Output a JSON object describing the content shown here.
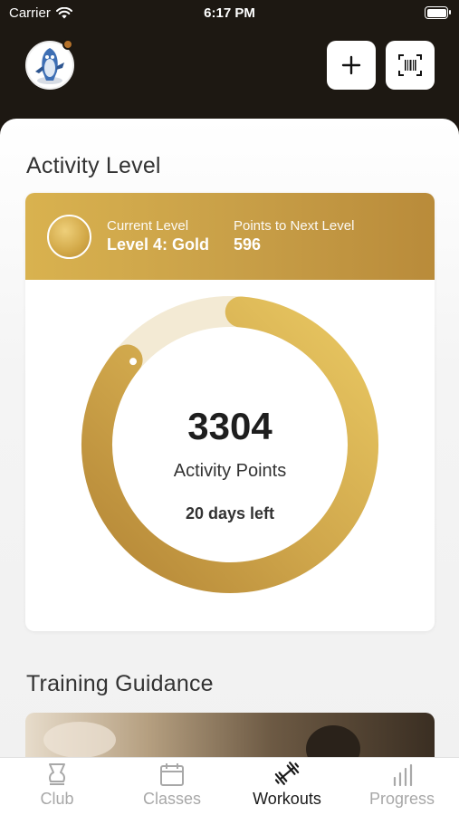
{
  "status_bar": {
    "carrier": "Carrier",
    "time": "6:17 PM"
  },
  "activity": {
    "title": "Activity Level",
    "current_level_label": "Current Level",
    "current_level_value": "Level 4: Gold",
    "points_next_label": "Points to Next Level",
    "points_next_value": "596",
    "points": "3304",
    "points_label": "Activity Points",
    "days_left": "20 days left",
    "progress_fraction": 0.847
  },
  "training": {
    "title": "Training Guidance"
  },
  "tabs": [
    {
      "label": "Club",
      "icon": "club-icon",
      "active": false
    },
    {
      "label": "Classes",
      "icon": "calendar-icon",
      "active": false
    },
    {
      "label": "Workouts",
      "icon": "dumbbell-icon",
      "active": true
    },
    {
      "label": "Progress",
      "icon": "bar-chart-icon",
      "active": false
    }
  ],
  "colors": {
    "gold_light": "#e8c35c",
    "gold_dark": "#b88a3a",
    "track": "#f3ead4",
    "header_bg": "#1d1812"
  }
}
